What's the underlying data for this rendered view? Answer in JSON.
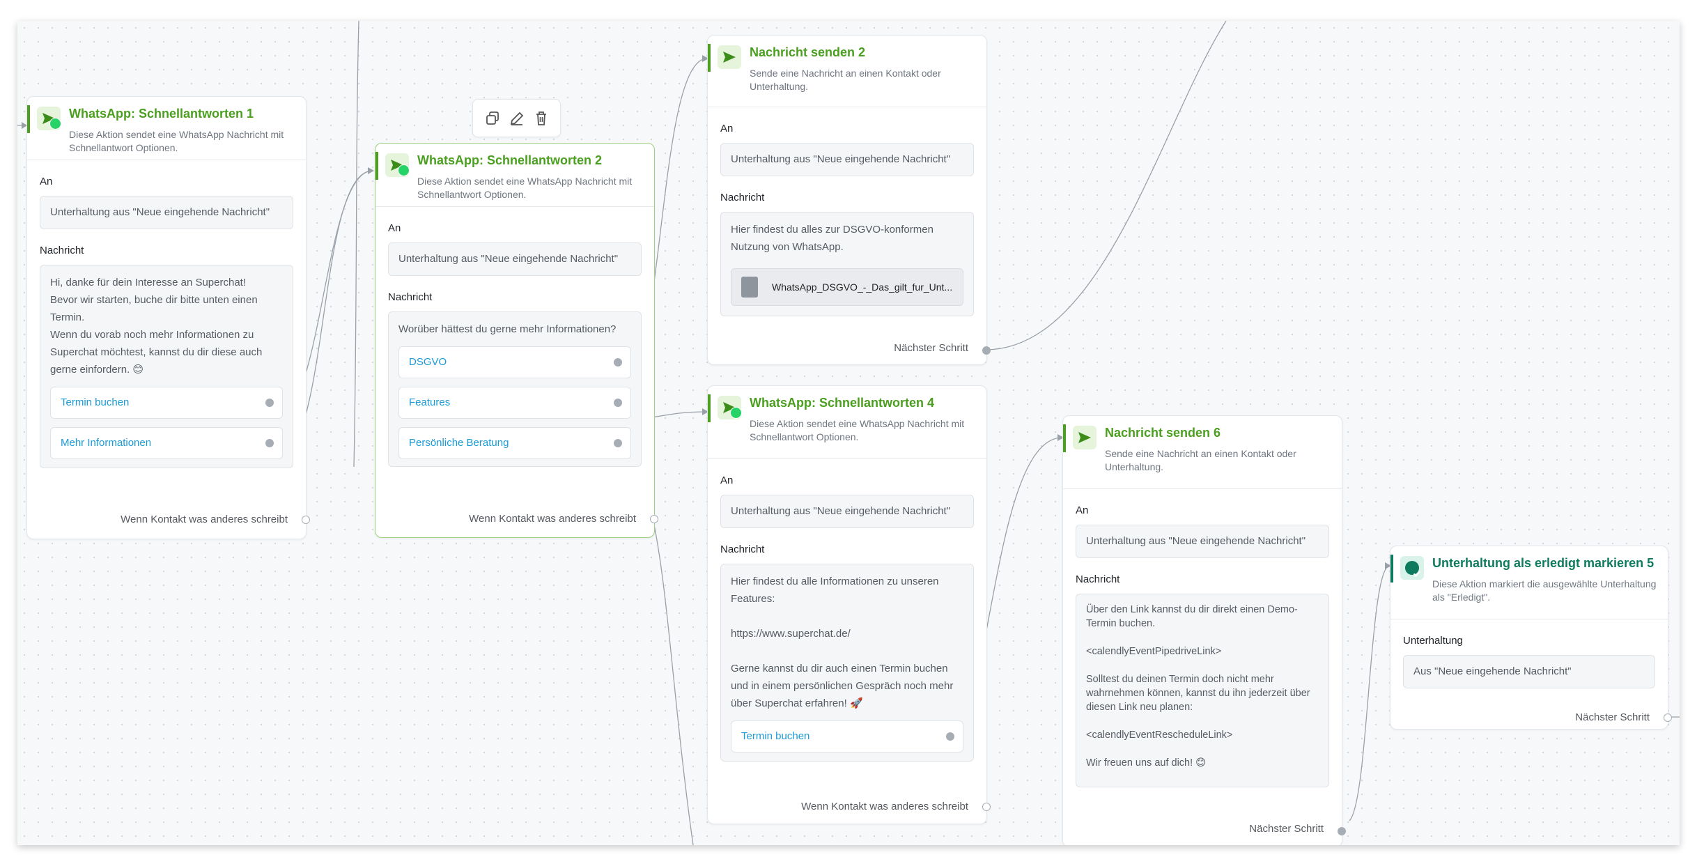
{
  "nodes": {
    "n1": {
      "title": "WhatsApp: Schnellantworten 1",
      "description": "Diese Aktion sendet eine WhatsApp Nachricht mit Schnellantwort Optionen.",
      "to_label": "An",
      "to_value": "Unterhaltung aus \"Neue eingehende Nachricht\"",
      "message_label": "Nachricht",
      "message": [
        "Hi, danke für dein Interesse an Superchat!",
        "Bevor wir starten, buche dir bitte unten einen Termin.",
        "Wenn du vorab noch mehr Informationen zu Superchat möchtest, kannst du dir diese auch gerne einfordern. 😊"
      ],
      "buttons": [
        "Termin buchen",
        "Mehr Informationen"
      ],
      "footer": "Wenn Kontakt was anderes schreibt"
    },
    "n2": {
      "title": "WhatsApp: Schnellantworten 2",
      "description": "Diese Aktion sendet eine WhatsApp Nachricht mit Schnellantwort Optionen.",
      "to_label": "An",
      "to_value": "Unterhaltung aus \"Neue eingehende Nachricht\"",
      "message_label": "Nachricht",
      "message": [
        "Worüber hättest du gerne mehr Informationen?"
      ],
      "buttons": [
        "DSGVO",
        "Features",
        "Persönliche Beratung"
      ],
      "footer": "Wenn Kontakt was anderes schreibt"
    },
    "n3": {
      "title": "Nachricht senden 2",
      "description": "Sende eine Nachricht an einen Kontakt oder Unterhaltung.",
      "to_label": "An",
      "to_value": "Unterhaltung aus \"Neue eingehende Nachricht\"",
      "message_label": "Nachricht",
      "message": [
        "Hier findest du alles zur DSGVO-konformen Nutzung von WhatsApp."
      ],
      "attachment": "WhatsApp_DSGVO_-_Das_gilt_fur_Unt...",
      "footer": "Nächster Schritt"
    },
    "n4": {
      "title": "WhatsApp: Schnellantworten 4",
      "description": "Diese Aktion sendet eine WhatsApp Nachricht mit Schnellantwort Optionen.",
      "to_label": "An",
      "to_value": "Unterhaltung aus \"Neue eingehende Nachricht\"",
      "message_label": "Nachricht",
      "message": [
        "Hier findest du alle Informationen zu unseren Features:",
        "",
        "https://www.superchat.de/",
        "",
        "Gerne kannst du dir auch einen Termin buchen und in einem persönlichen Gespräch noch mehr über Superchat erfahren! 🚀"
      ],
      "buttons": [
        "Termin buchen"
      ],
      "footer": "Wenn Kontakt was anderes schreibt"
    },
    "n5": {
      "title": "Nachricht senden 6",
      "description": "Sende eine Nachricht an einen Kontakt oder Unterhaltung.",
      "to_label": "An",
      "to_value": "Unterhaltung aus \"Neue eingehende Nachricht\"",
      "message_label": "Nachricht",
      "message": [
        "Über den Link kannst du dir direkt einen Demo-Termin buchen.",
        "",
        "<calendlyEventPipedriveLink>",
        "",
        "Solltest du deinen Termin doch nicht mehr wahrnehmen können, kannst du ihn jederzeit über diesen Link neu planen:",
        "",
        "<calendlyEventRescheduleLink>",
        "",
        "Wir freuen uns auf dich! 😊"
      ],
      "footer": "Nächster Schritt"
    },
    "n6": {
      "title": "Unterhaltung als erledigt markieren 5",
      "description": "Diese Aktion markiert die ausgewählte Unterhaltung als \"Erledigt\".",
      "field_label": "Unterhaltung",
      "field_value": "Aus \"Neue eingehende Nachricht\"",
      "footer": "Nächster Schritt"
    }
  },
  "toolbar": {
    "icons": [
      "duplicate-icon",
      "edit-icon",
      "delete-icon"
    ]
  },
  "colors": {
    "accent_green": "#4a9f1f",
    "teal": "#0e7b5e",
    "link_blue": "#1a9ad6",
    "whatsapp_green": "#25d366"
  }
}
